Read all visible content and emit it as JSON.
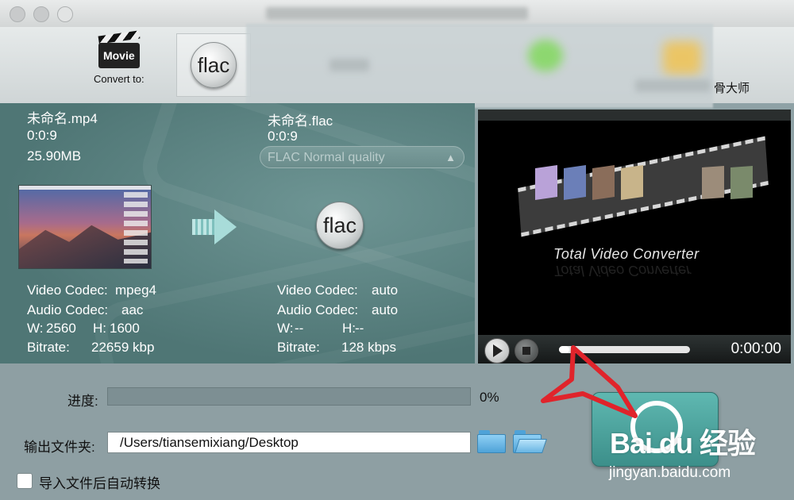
{
  "toolbar": {
    "movie_icon_text": "Movie",
    "convert_to_label": "Convert to:",
    "flac_label": "flac",
    "partial_label": "骨大师"
  },
  "source": {
    "file_name": "未命名.mp4",
    "duration": "0:0:9",
    "size": "25.90MB",
    "video_codec_label": "Video Codec:",
    "video_codec": "mpeg4",
    "audio_codec_label": "Audio Codec:",
    "audio_codec": "aac",
    "w_label": "W:",
    "width": "2560",
    "h_label": "H:",
    "height": "1600",
    "bitrate_label": "Bitrate:",
    "bitrate": "22659 kbp"
  },
  "target": {
    "file_name": "未命名.flac",
    "duration": "0:0:9",
    "quality": "FLAC Normal quality",
    "flac_icon_text": "flac",
    "video_codec_label": "Video Codec:",
    "video_codec": "auto",
    "audio_codec_label": "Audio Codec:",
    "audio_codec": "auto",
    "w_label": "W:",
    "width": "--",
    "h_label": "H:",
    "height": "--",
    "bitrate_label": "Bitrate:",
    "bitrate": "128 kbps"
  },
  "preview": {
    "logo_text": "Total Video Converter",
    "time": "0:00:00",
    "seek_fraction": 0.08
  },
  "bottom": {
    "progress_label": "进度:",
    "progress_percent": "0%",
    "progress_value": 0,
    "output_label": "输出文件夹:",
    "output_path": "/Users/tiansemixiang/Desktop",
    "auto_convert_label": "导入文件后自动转换",
    "auto_convert_checked": false
  },
  "watermark": {
    "brand": "Bai du 经验",
    "url": "jingyan.baidu.com"
  },
  "colors": {
    "panel_teal": "#5b8281",
    "accent_red": "#e0242b",
    "convert_button": "#4aa39d"
  }
}
